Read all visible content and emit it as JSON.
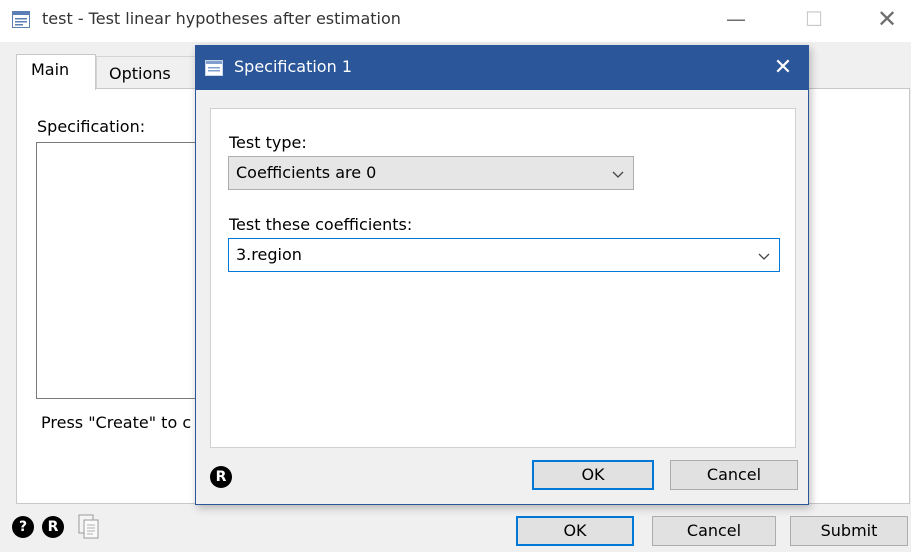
{
  "parent": {
    "title": "test - Test linear hypotheses after estimation",
    "window_controls": {
      "minimize": "—",
      "maximize": "☐",
      "close": "✕"
    },
    "tabs": [
      {
        "label": "Main"
      },
      {
        "label": "Options"
      }
    ],
    "specification_label": "Specification:",
    "press_create_text": "Press \"Create\" to c",
    "footer": {
      "help_icon": "?",
      "r_icon": "R",
      "ok_label": "OK",
      "cancel_label": "Cancel",
      "submit_label": "Submit"
    }
  },
  "child": {
    "title": "Specification 1",
    "close": "✕",
    "test_type_label": "Test type:",
    "test_type_value": "Coefficients are 0",
    "coefficients_label": "Test these coefficients:",
    "coefficients_value": "3.region",
    "r_icon": "R",
    "ok_label": "OK",
    "cancel_label": "Cancel"
  },
  "colors": {
    "child_titlebar": "#2b579a",
    "focus_accent": "#0078d7",
    "dialog_bg": "#f0f0f0"
  }
}
